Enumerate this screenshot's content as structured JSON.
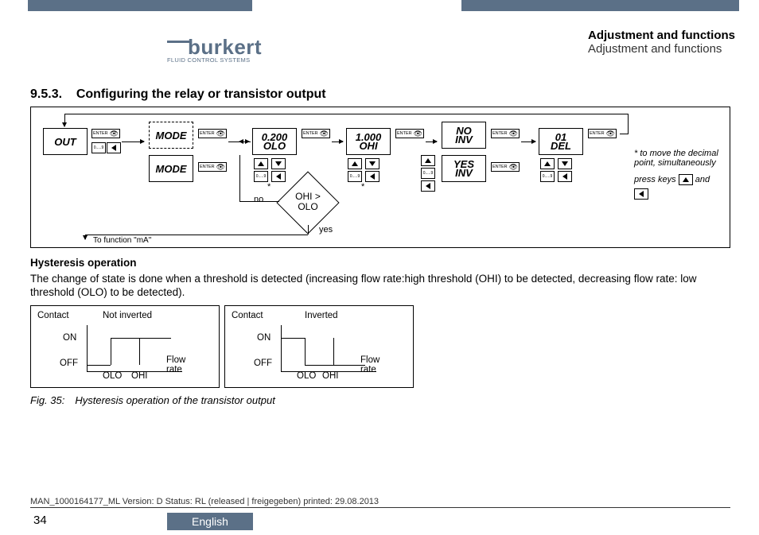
{
  "header": {
    "logo_name": "burkert",
    "logo_tagline": "FLUID CONTROL SYSTEMS",
    "title_bold": "Adjustment and functions",
    "title_norm": "Adjustment and functions"
  },
  "section": {
    "number": "9.5.3.",
    "title": "Configuring the relay or transistor output"
  },
  "diagram": {
    "out": "OUT",
    "mode1": "MODE",
    "mode2": "MODE",
    "olo_v": "0.200",
    "olo_l": "OLO",
    "ohi_v": "1.000",
    "ohi_l": "OHI",
    "no_l1": "NO",
    "no_l2": "INV",
    "yes_l1": "YES",
    "yes_l2": "INV",
    "del_l1": "01",
    "del_l2": "DEL",
    "enter": "ENTER",
    "zero_nine": "0.....9",
    "star": "*",
    "no": "no",
    "yes": "yes",
    "decision_l1": "OHI >",
    "decision_l2": "OLO",
    "to_function": "To function \"mA\"",
    "note_l1": "* to move the decimal",
    "note_l2": "point, simultaneously",
    "note_l3": "press keys",
    "note_l4": "and"
  },
  "body": {
    "hyst_heading": "Hysteresis operation",
    "hyst_text": "The change of state is done when a threshold is detected  (increasing flow rate:high threshold (OHI) to be detected, decreasing flow rate: low threshold (OLO) to be detected)."
  },
  "hyst": {
    "contact": "Contact",
    "not_inverted": "Not inverted",
    "inverted": "Inverted",
    "on": "ON",
    "off": "OFF",
    "olo": "OLO",
    "ohi": "OHI",
    "flow_l1": "Flow",
    "flow_l2": "rate"
  },
  "fig_caption": "Fig. 35: Hysteresis operation of the transistor output",
  "footer": {
    "line": "MAN_1000164177_ML  Version: D Status: RL (released | freigegeben)  printed: 29.08.2013",
    "page": "34",
    "language": "English"
  }
}
